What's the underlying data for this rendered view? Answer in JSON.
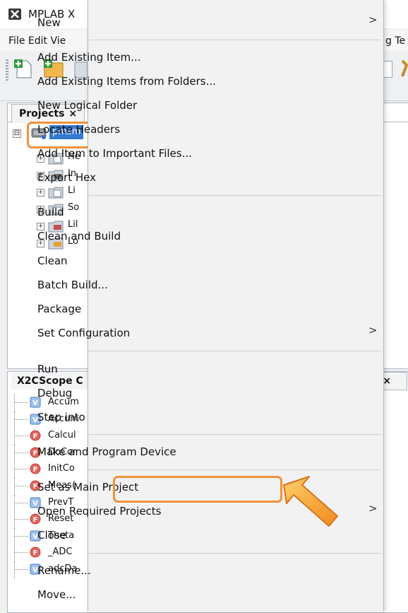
{
  "window": {
    "title": "MPLAB X"
  },
  "menubar": {
    "visible_text": "File  Edit  Vie",
    "right_text": "g  Te"
  },
  "projects_panel": {
    "tab_label": "Projects",
    "tab_close": "×",
    "root": {
      "label": "pmsm",
      "expander": "⊟"
    },
    "children": [
      {
        "label": "He",
        "icon": "header-files-folder-icon"
      },
      {
        "label": "In",
        "icon": "important-files-folder-icon"
      },
      {
        "label": "Li",
        "icon": "linker-files-folder-icon"
      },
      {
        "label": "So",
        "icon": "source-files-folder-icon"
      },
      {
        "label": "Lil",
        "icon": "libraries-folder-icon"
      },
      {
        "label": "Lo",
        "icon": "loadables-folder-icon"
      }
    ]
  },
  "x2cscope_panel": {
    "tab_label": "X2CScope C",
    "right_tab": ". ×",
    "items": [
      {
        "label": "Accum",
        "kind": "V"
      },
      {
        "label": "Accum",
        "kind": "V"
      },
      {
        "label": "Calcul",
        "kind": "F"
      },
      {
        "label": "DoCor",
        "kind": "F"
      },
      {
        "label": "InitCo",
        "kind": "F"
      },
      {
        "label": "Meas(",
        "kind": "F"
      },
      {
        "label": "PrevT",
        "kind": "V"
      },
      {
        "label": "Reset",
        "kind": "F"
      },
      {
        "label": "Theta",
        "kind": "V"
      },
      {
        "label": "_ADC",
        "kind": "F"
      },
      {
        "label": "adcDa",
        "kind": "V"
      }
    ]
  },
  "context_menu": {
    "submenu_arrow": ">",
    "items": {
      "new": "New",
      "add_existing_item": "Add Existing Item...",
      "add_existing_items_folders": "Add Existing Items from Folders...",
      "new_logical_folder": "New Logical Folder",
      "locate_headers": "Locate Headers",
      "add_important": "Add Item to Important Files...",
      "export_hex": "Export Hex",
      "build": "Build",
      "clean_and_build": "Clean and Build",
      "clean": "Clean",
      "batch_build": "Batch Build...",
      "package": "Package",
      "set_configuration": "Set Configuration",
      "run": "Run",
      "debug": "Debug",
      "step_into": "Step into",
      "make_and_program": "Make and Program Device",
      "set_as_main": "Set as Main Project",
      "open_required": "Open Required Projects",
      "close": "Close",
      "rename": "Rename...",
      "move": "Move..."
    }
  },
  "colors": {
    "highlight_orange": "#f0923a",
    "selection_blue": "#3478d0",
    "menu_bg": "#f2f2f2"
  }
}
